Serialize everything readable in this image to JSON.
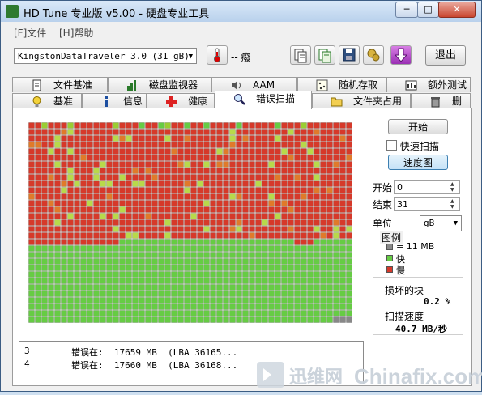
{
  "window": {
    "title": "HD Tune 专业版 v5.00 - 硬盘专业工具"
  },
  "menu": [
    {
      "label": "[F]文件"
    },
    {
      "label": "[H]帮助"
    }
  ],
  "toolbar": {
    "drive": "KingstonDataTraveler 3.0 (31 gB)",
    "temperature": "-- 癈",
    "exit_label": "退出"
  },
  "tabs_row1": [
    {
      "label": "文件基准",
      "icon": "file-benchmark-icon"
    },
    {
      "label": "磁盘监视器",
      "icon": "disk-monitor-icon"
    },
    {
      "label": "AAM",
      "icon": "speaker-icon"
    },
    {
      "label": "随机存取",
      "icon": "random-access-icon"
    },
    {
      "label": "额外测试",
      "icon": "extra-tests-icon"
    }
  ],
  "tabs_row2": [
    {
      "label": "基准",
      "icon": "lightbulb-icon"
    },
    {
      "label": "信息",
      "icon": "info-icon"
    },
    {
      "label": "健康",
      "icon": "health-cross-icon"
    },
    {
      "label": "错误扫描",
      "icon": "magnifier-icon",
      "active": true
    },
    {
      "label": "文件夹占用率",
      "icon": "folder-icon"
    },
    {
      "label": "删除",
      "icon": "trash-icon"
    }
  ],
  "controls": {
    "start_button": "开始",
    "quick_scan_label": "快速扫描",
    "quick_scan_checked": false,
    "speed_map_button": "速度图",
    "start_label": "开始",
    "start_value": "0",
    "end_label": "结束",
    "end_value": "31",
    "unit_label": "单位",
    "unit_value": "gB"
  },
  "legend": {
    "title": "图例",
    "block_size": "= 11 MB",
    "fast": "快",
    "slow": "慢"
  },
  "stats": {
    "damaged_label": "损坏的块",
    "damaged_value": "0.2 %",
    "speed_label": "扫描速度",
    "speed_value": "40.7 MB/秒"
  },
  "log": [
    {
      "index": "3",
      "text": "错误在:  17659 MB  (LBA 36165..."
    },
    {
      "index": "4",
      "text": "错误在:  17660 MB  (LBA 36168..."
    }
  ],
  "colors": {
    "fast": "#66cc44",
    "slow": "#d6392a",
    "unscanned": "#888888",
    "panel_bg": "#f0f0f0"
  },
  "watermark": {
    "brand_cn": "迅维网",
    "brand_en": "Chinafix.com"
  }
}
